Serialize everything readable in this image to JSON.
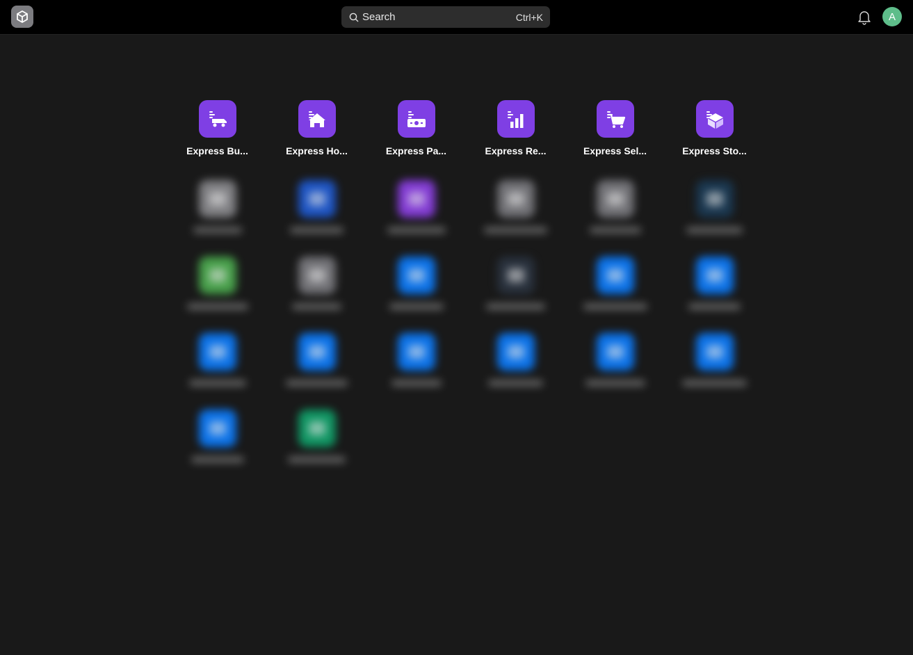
{
  "topbar": {
    "logo_icon": "cube-icon",
    "search": {
      "label": "Search",
      "shortcut": "Ctrl+K",
      "icon": "search-icon"
    },
    "notifications_icon": "bell-icon",
    "avatar_initial": "A",
    "avatar_color": "#5ebd8a"
  },
  "apps": [
    {
      "label": "Express Bu...",
      "icon": "delivery-truck-icon",
      "color": "#7f3fe4"
    },
    {
      "label": "Express Ho...",
      "icon": "home-icon",
      "color": "#7f3fe4"
    },
    {
      "label": "Express Pa...",
      "icon": "banknote-icon",
      "color": "#7f3fe4"
    },
    {
      "label": "Express Re...",
      "icon": "bar-chart-icon",
      "color": "#7f3fe4"
    },
    {
      "label": "Express Sel...",
      "icon": "shopping-cart-icon",
      "color": "#7f3fe4"
    },
    {
      "label": "Express Sto...",
      "icon": "box-icon",
      "color": "#7f3fe4"
    }
  ],
  "blurred_apps": [
    {
      "color": "#8a8a8e"
    },
    {
      "color": "#1e5bd6"
    },
    {
      "color": "#8e3fe8"
    },
    {
      "color": "#7b7b80"
    },
    {
      "color": "#7b7b80"
    },
    {
      "color": "#1a3a55"
    },
    {
      "color": "#4cae4f"
    },
    {
      "color": "#7b7b80"
    },
    {
      "color": "#0a7cff"
    },
    {
      "color": "#2a3340"
    },
    {
      "color": "#0a7cff"
    },
    {
      "color": "#0a7cff"
    },
    {
      "color": "#0a7cff"
    },
    {
      "color": "#0a7cff"
    },
    {
      "color": "#0a7cff"
    },
    {
      "color": "#0a7cff"
    },
    {
      "color": "#0a7cff"
    },
    {
      "color": "#0a7cff"
    },
    {
      "color": "#0a7cff"
    },
    {
      "color": "#0fa36b"
    }
  ]
}
